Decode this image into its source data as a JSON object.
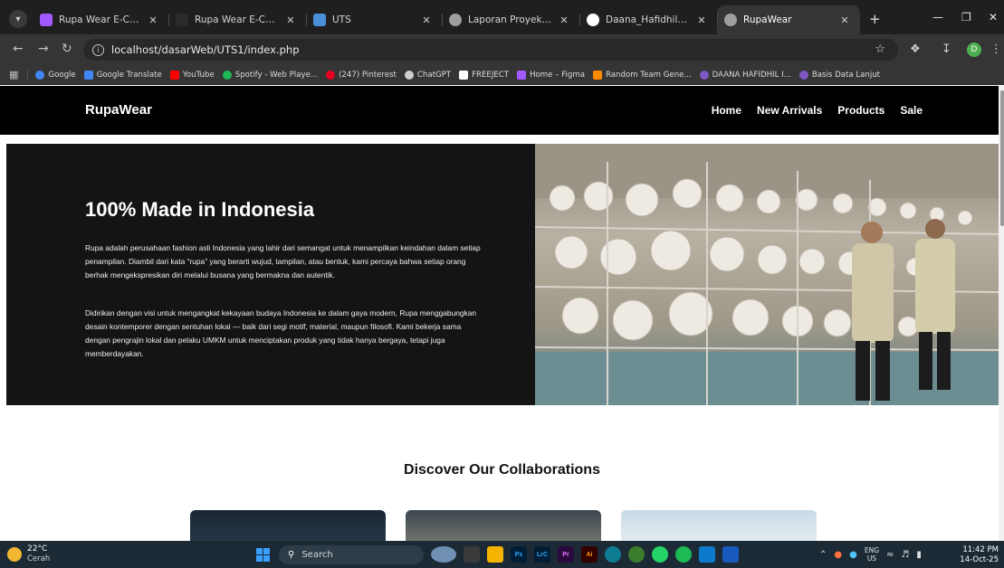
{
  "browser": {
    "tabs": [
      {
        "title": "Rupa Wear E-Commerce -",
        "icon_color": "#a259ff",
        "active": false
      },
      {
        "title": "Rupa Wear E-Commerce",
        "icon_color": "#2b2b2b",
        "active": false
      },
      {
        "title": "UTS",
        "icon_color": "#4a90d9",
        "active": false
      },
      {
        "title": "Laporan Proyek UTS.docx",
        "icon_color": "#9e9e9e",
        "active": false
      },
      {
        "title": "Daana_Hafidhil_Islam_DES",
        "icon_color": "#ffffff",
        "active": false
      },
      {
        "title": "RupaWear",
        "icon_color": "#9e9e9e",
        "active": true
      }
    ],
    "url": "localhost/dasarWeb/UTS1/index.php",
    "profile_initial": "D",
    "bookmarks": [
      {
        "label": "Google",
        "icon_color": "#4285f4"
      },
      {
        "label": "Google Translate",
        "icon_color": "#4285f4"
      },
      {
        "label": "YouTube",
        "icon_color": "#ff0000"
      },
      {
        "label": "Spotify - Web Playe...",
        "icon_color": "#1db954"
      },
      {
        "label": "(247) Pinterest",
        "icon_color": "#e60023"
      },
      {
        "label": "ChatGPT",
        "icon_color": "#cfcfcf"
      },
      {
        "label": "FREEJECT",
        "icon_color": "#ffffff"
      },
      {
        "label": "Home – Figma",
        "icon_color": "#a259ff"
      },
      {
        "label": "Random Team Gene...",
        "icon_color": "#ff8a00"
      },
      {
        "label": "DAANA HAFIDHIL I...",
        "icon_color": "#7e57c2"
      },
      {
        "label": "Basis Data Lanjut",
        "icon_color": "#7e57c2"
      }
    ]
  },
  "site": {
    "logo": "RupaWear",
    "nav": {
      "home": "Home",
      "new_arrivals": "New Arrivals",
      "products": "Products",
      "sale": "Sale"
    },
    "hero": {
      "title": "100% Made in Indonesia",
      "paragraph1": "Rupa adalah perusahaan fashion asli Indonesia yang lahir dari semangat untuk menampilkan keindahan dalam setiap penampilan. Diambil dari kata “rupa” yang berarti wujud, tampilan, atau bentuk, kami percaya bahwa setiap orang berhak mengekspresikan diri melalui busana yang bermakna dan autentik.",
      "paragraph2": "Didirikan dengan visi untuk mengangkat kekayaan budaya Indonesia ke dalam gaya modern, Rupa menggabungkan desain kontemporer dengan sentuhan lokal — baik dari segi motif, material, maupun filosofi. Kami bekerja sama dengan pengrajin lokal dan pelaku UMKM untuk menciptakan produk yang tidak hanya bergaya, tetapi juga memberdayakan."
    },
    "collab_title": "Discover Our Collaborations"
  },
  "taskbar": {
    "temperature": "22°C",
    "condition": "Cerah",
    "search_placeholder": "Search",
    "apps": [
      {
        "label": "",
        "color": "#6f8fb3"
      },
      {
        "label": "",
        "color": "#3a3a3a"
      },
      {
        "label": "",
        "color": "#f4b400"
      },
      {
        "label": "Ps",
        "color": "#001e36"
      },
      {
        "label": "LrC",
        "color": "#001e36"
      },
      {
        "label": "Pr",
        "color": "#2a0a3d"
      },
      {
        "label": "Ai",
        "color": "#330000"
      },
      {
        "label": "",
        "color": "#0f7b93"
      },
      {
        "label": "",
        "color": "#3c7d2c"
      },
      {
        "label": "",
        "color": "#25d366"
      },
      {
        "label": "",
        "color": "#1db954"
      },
      {
        "label": "",
        "color": "#0e7acc"
      },
      {
        "label": "",
        "color": "#185abd"
      }
    ],
    "lang_top": "ENG",
    "lang_bottom": "US",
    "time": "11:42 PM",
    "date": "14-Oct-25"
  }
}
